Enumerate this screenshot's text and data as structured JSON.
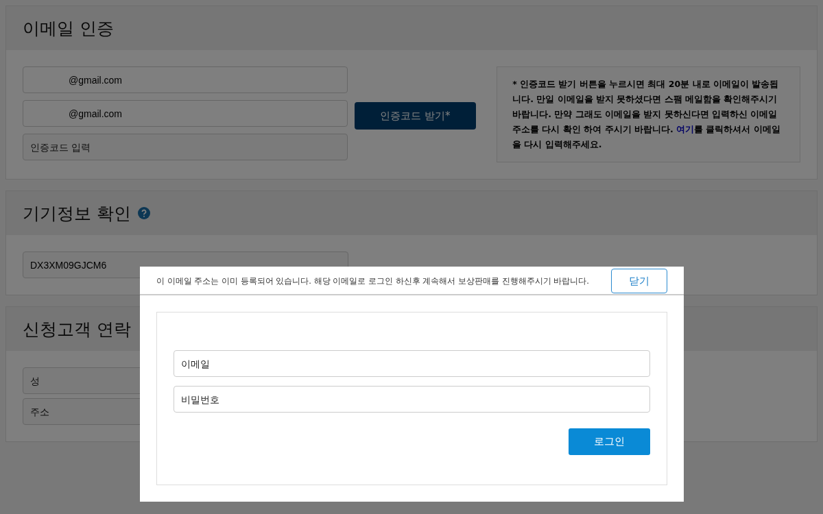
{
  "email_verification": {
    "title": "이메일 인증",
    "email_field": {
      "value": "@gmail.com"
    },
    "confirm_email_field": {
      "value": "@gmail.com"
    },
    "code_field": {
      "placeholder": "인증코드 입력"
    },
    "send_code_button": "인증코드 받기*",
    "notice": {
      "before": "* 인증코드 받기 버튼을 누르시면 최대 20분 내로 이메일이 발송됩니다. 만일 이메일을 받지 못하셨다면 스팸 메일함을 확인해주시기 바랍니다. 만약 그래도 이메일을 받지 못하신다면 입력하신 이메일 주소를 다시 확인 하여 주시기 바랍니다. ",
      "link": "여기",
      "after": "를 클릭하셔서 이메일을 다시 입력해주세요."
    }
  },
  "device_info": {
    "title": "기기정보 확인",
    "serial_field": {
      "value": "DX3XM09GJCM6"
    }
  },
  "contact": {
    "title": "신청고객 연락",
    "fields": [
      {
        "placeholder": "성"
      },
      {
        "placeholder": "주소"
      }
    ]
  },
  "modal": {
    "message": "이 이메일 주소는 이미 등록되어 있습니다. 해당 이메일로 로그인 하신후 계속해서 보상판매를 진행해주시기 바랍니다.",
    "close_button": "닫기",
    "email_field": {
      "placeholder": "이메일"
    },
    "password_field": {
      "placeholder": "비밀번호"
    },
    "login_button": "로그인"
  }
}
